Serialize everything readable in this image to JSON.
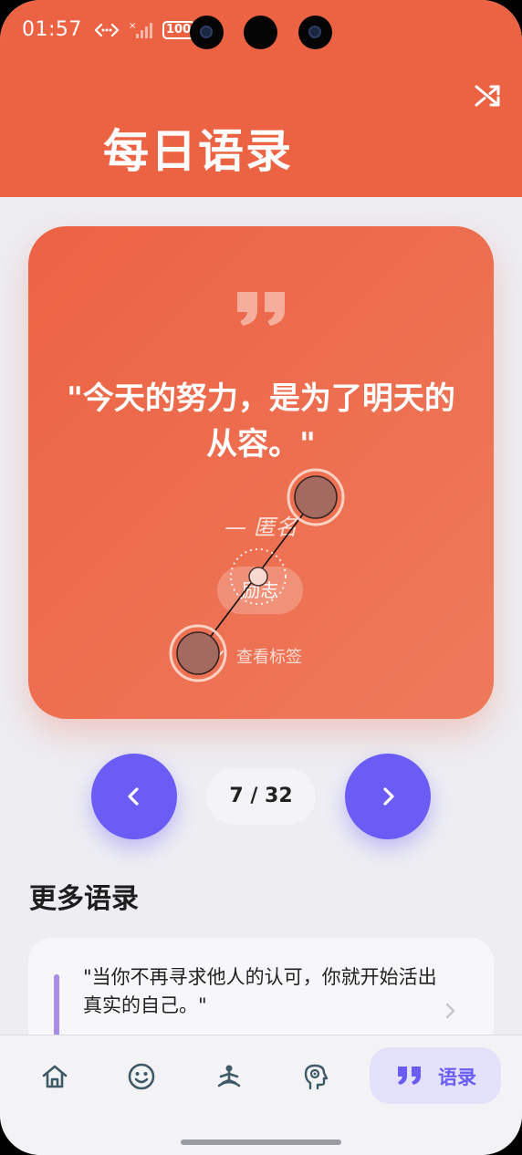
{
  "status_bar": {
    "time": "01:57",
    "battery": "100"
  },
  "header": {
    "title": "每日语录",
    "shuffle_icon": "shuffle-icon"
  },
  "quote": {
    "text": "\"今天的努力，是为了明天的从容。\"",
    "author": "— 匿名",
    "tag": "励志",
    "view_tags": "查看标签"
  },
  "pager": {
    "indicator": "7 / 32",
    "prev_icon": "chevron-left-icon",
    "next_icon": "chevron-right-icon"
  },
  "more": {
    "title": "更多语录",
    "items": [
      {
        "text": "\"当你不再寻求他人的认可，你就开始活出真实的自己。\""
      }
    ]
  },
  "bottom_nav": {
    "items": [
      {
        "icon": "home-icon"
      },
      {
        "icon": "smiley-icon"
      },
      {
        "icon": "meditation-icon"
      },
      {
        "icon": "head-brain-icon"
      },
      {
        "icon": "quote-icon",
        "label": "语录",
        "active": true
      }
    ]
  },
  "colors": {
    "header": "#ec6344",
    "accent": "#6a5cf5",
    "background": "#ededf2"
  }
}
